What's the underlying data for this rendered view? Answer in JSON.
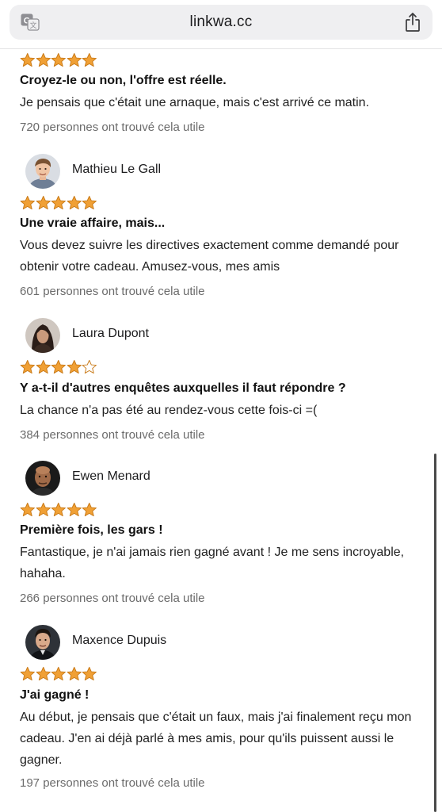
{
  "browser": {
    "url": "linkwa.cc",
    "translate_icon": "translate-icon",
    "share_icon": "share-icon"
  },
  "colors": {
    "star_fill": "#f0a035",
    "star_stroke": "#c97a18"
  },
  "reviews": [
    {
      "author": "",
      "rating": 5,
      "title": "Croyez-le ou non, l'offre est réelle.",
      "body": "Je pensais que c'était une arnaque, mais c'est arrivé ce matin.",
      "helpful": "720 personnes ont trouvé cela utile"
    },
    {
      "author": "Mathieu Le Gall",
      "rating": 5,
      "title": "Une vraie affaire, mais...",
      "body": "Vous devez suivre les directives exactement comme demandé pour obtenir votre cadeau. Amusez-vous, mes amis",
      "helpful": "601 personnes ont trouvé cela utile"
    },
    {
      "author": "Laura Dupont",
      "rating": 4,
      "title": "Y a-t-il d'autres enquêtes auxquelles il faut répondre ?",
      "body": "La chance n'a pas été au rendez-vous cette fois-ci =(",
      "helpful": "384 personnes ont trouvé cela utile"
    },
    {
      "author": "Ewen Menard",
      "rating": 5,
      "title": "Première fois, les gars !",
      "body": "Fantastique, je n'ai jamais rien gagné avant ! Je me sens incroyable, hahaha.",
      "helpful": "266 personnes ont trouvé cela utile"
    },
    {
      "author": "Maxence Dupuis",
      "rating": 5,
      "title": "J'ai gagné !",
      "body": "Au début, je pensais que c'était un faux, mais j'ai finalement reçu mon cadeau. J'en ai déjà parlé à mes amis, pour qu'ils puissent aussi le gagner.",
      "helpful": "197 personnes ont trouvé cela utile"
    }
  ]
}
